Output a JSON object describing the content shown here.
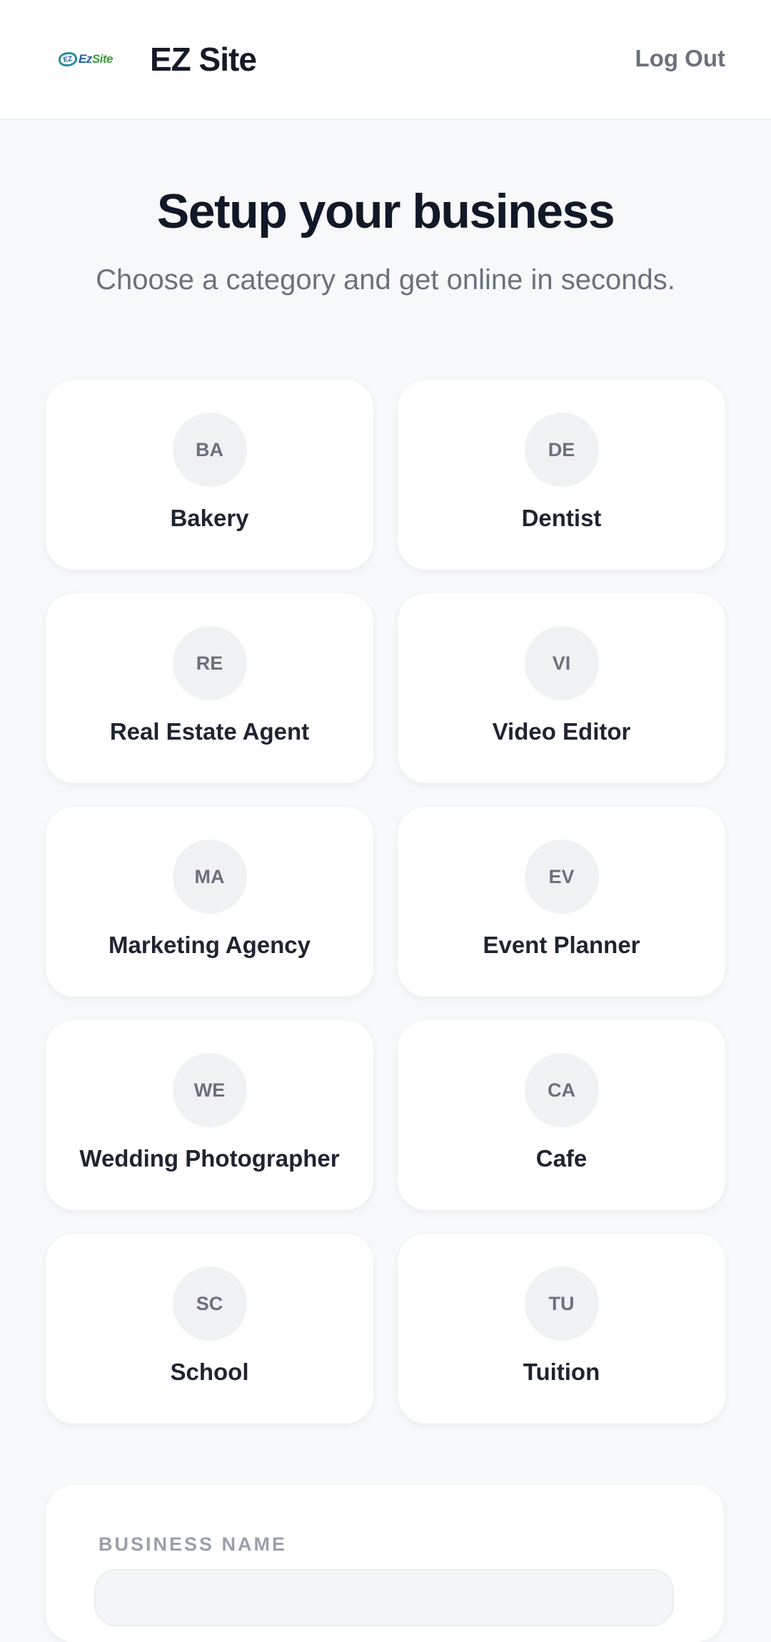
{
  "header": {
    "logo_text": "EzSite",
    "logo_mark": "EZ",
    "brand": "EZ Site",
    "logout_label": "Log Out"
  },
  "hero": {
    "title": "Setup your business",
    "subtitle": "Choose a category and get online in seconds."
  },
  "categories": [
    {
      "initials": "BA",
      "label": "Bakery"
    },
    {
      "initials": "DE",
      "label": "Dentist"
    },
    {
      "initials": "RE",
      "label": "Real Estate Agent"
    },
    {
      "initials": "VI",
      "label": "Video Editor"
    },
    {
      "initials": "MA",
      "label": "Marketing Agency"
    },
    {
      "initials": "EV",
      "label": "Event Planner"
    },
    {
      "initials": "WE",
      "label": "Wedding Photographer"
    },
    {
      "initials": "CA",
      "label": "Cafe"
    },
    {
      "initials": "SC",
      "label": "School"
    },
    {
      "initials": "TU",
      "label": "Tuition"
    }
  ],
  "form": {
    "business_name_label": "BUSINESS NAME",
    "business_name_value": ""
  },
  "colors": {
    "background": "#f7f8fa",
    "card": "#ffffff",
    "badge": "#f0f1f3",
    "text_primary": "#111827",
    "text_muted": "#6b717c"
  }
}
